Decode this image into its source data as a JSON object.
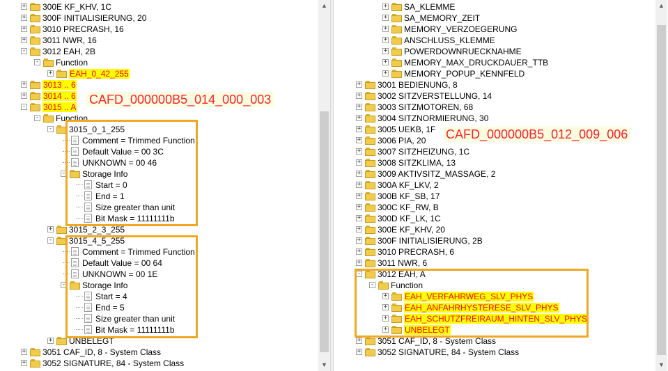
{
  "left": {
    "nodes": [
      {
        "label": "300E KF_KHV, 1C",
        "type": "folder",
        "expander": "+",
        "depth": 0
      },
      {
        "label": "300F INITIALISIERUNG, 20",
        "type": "folder",
        "expander": "+",
        "depth": 0
      },
      {
        "label": "3010 PRECRASH, 16",
        "type": "folder",
        "expander": "+",
        "depth": 0
      },
      {
        "label": "3011 NWR, 16",
        "type": "folder",
        "expander": "+",
        "depth": 0
      },
      {
        "label": "3012 EAH, 2B",
        "type": "folder",
        "expander": "-",
        "depth": 0
      },
      {
        "label": "Function",
        "type": "folder",
        "expander": "-",
        "depth": 1
      },
      {
        "label": "EAH_0_42_255",
        "type": "folder",
        "expander": "+",
        "depth": 2,
        "highlight": "band"
      },
      {
        "label": "3013 .. 6",
        "type": "folder",
        "expander": "+",
        "depth": 0,
        "highlight": "band"
      },
      {
        "label": "3014 .. 6",
        "type": "folder",
        "expander": "+",
        "depth": 0,
        "highlight": "band"
      },
      {
        "label": "3015 .. A",
        "type": "folder",
        "expander": "-",
        "depth": 0,
        "highlight": "band"
      },
      {
        "label": "Function",
        "type": "folder",
        "expander": "-",
        "depth": 1
      },
      {
        "label": "3015_0_1_255",
        "type": "folder",
        "expander": "-",
        "depth": 2
      },
      {
        "label": "Comment = Trimmed Function",
        "type": "doc",
        "depth": 3
      },
      {
        "label": "Default Value =  00 3C",
        "type": "doc",
        "depth": 3
      },
      {
        "label": "UNKNOWN = 00 46",
        "type": "doc",
        "depth": 3
      },
      {
        "label": "Storage Info",
        "type": "folder",
        "expander": "-",
        "depth": 3
      },
      {
        "label": "Start = 0",
        "type": "doc",
        "depth": 4
      },
      {
        "label": "End = 1",
        "type": "doc",
        "depth": 4
      },
      {
        "label": "Size greater than unit",
        "type": "doc",
        "depth": 4
      },
      {
        "label": "Bit Mask = 11111111b",
        "type": "doc",
        "depth": 4
      },
      {
        "label": "3015_2_3_255",
        "type": "folder",
        "expander": "+",
        "depth": 2
      },
      {
        "label": "3015_4_5_255",
        "type": "folder",
        "expander": "-",
        "depth": 2
      },
      {
        "label": "Comment = Trimmed Function",
        "type": "doc",
        "depth": 3
      },
      {
        "label": "Default Value =  00 64",
        "type": "doc",
        "depth": 3
      },
      {
        "label": "UNKNOWN = 00 1E",
        "type": "doc",
        "depth": 3
      },
      {
        "label": "Storage Info",
        "type": "folder",
        "expander": "-",
        "depth": 3
      },
      {
        "label": "Start = 4",
        "type": "doc",
        "depth": 4
      },
      {
        "label": "End = 5",
        "type": "doc",
        "depth": 4
      },
      {
        "label": "Size greater than unit",
        "type": "doc",
        "depth": 4
      },
      {
        "label": "Bit Mask = 11111111b",
        "type": "doc",
        "depth": 4
      },
      {
        "label": "UNBELEGT",
        "type": "folder",
        "expander": "+",
        "depth": 2
      },
      {
        "label": "3051 CAF_ID, 8  - System Class",
        "type": "folder",
        "expander": "+",
        "depth": 0
      },
      {
        "label": "3052 SIGNATURE, 84  - System Class",
        "type": "folder",
        "expander": "+",
        "depth": 0
      }
    ],
    "annotation": "CAFD_000000B5_014_000_003"
  },
  "right": {
    "nodes": [
      {
        "label": "SA_KLEMME",
        "type": "folder",
        "expander": "+",
        "depth": 2
      },
      {
        "label": "SA_MEMORY_ZEIT",
        "type": "folder",
        "expander": "+",
        "depth": 2
      },
      {
        "label": "MEMORY_VERZOEGERUNG",
        "type": "folder",
        "expander": "+",
        "depth": 2
      },
      {
        "label": "ANSCHLUSS_KLEMME",
        "type": "folder",
        "expander": "+",
        "depth": 2
      },
      {
        "label": "POWERDOWNRUECKNAHME",
        "type": "folder",
        "expander": "+",
        "depth": 2
      },
      {
        "label": "MEMORY_MAX_DRUCKDAUER_TTB",
        "type": "folder",
        "expander": "+",
        "depth": 2
      },
      {
        "label": "MEMORY_POPUP_KENNFELD",
        "type": "folder",
        "expander": "+",
        "depth": 2
      },
      {
        "label": "3001 BEDIENUNG, 8",
        "type": "folder",
        "expander": "+",
        "depth": 0
      },
      {
        "label": "3002 SITZVERSTELLUNG, 14",
        "type": "folder",
        "expander": "+",
        "depth": 0
      },
      {
        "label": "3003 SITZMOTOREN, 68",
        "type": "folder",
        "expander": "+",
        "depth": 0
      },
      {
        "label": "3004 SITZNORMIERUNG, 30",
        "type": "folder",
        "expander": "+",
        "depth": 0
      },
      {
        "label": "3005 UEKB, 1F",
        "type": "folder",
        "expander": "+",
        "depth": 0
      },
      {
        "label": "3006 PIA, 20",
        "type": "folder",
        "expander": "+",
        "depth": 0
      },
      {
        "label": "3007 SITZHEIZUNG, 1C",
        "type": "folder",
        "expander": "+",
        "depth": 0
      },
      {
        "label": "3008 SITZKLIMA, 13",
        "type": "folder",
        "expander": "+",
        "depth": 0
      },
      {
        "label": "3009 AKTIVSITZ_MASSAGE, 2",
        "type": "folder",
        "expander": "+",
        "depth": 0
      },
      {
        "label": "300A KF_LKV, 2",
        "type": "folder",
        "expander": "+",
        "depth": 0
      },
      {
        "label": "300B KF_SB, 17",
        "type": "folder",
        "expander": "+",
        "depth": 0
      },
      {
        "label": "300C KF_RW, B",
        "type": "folder",
        "expander": "+",
        "depth": 0
      },
      {
        "label": "300D KF_LK, 1C",
        "type": "folder",
        "expander": "+",
        "depth": 0
      },
      {
        "label": "300E KF_KHV, 20",
        "type": "folder",
        "expander": "+",
        "depth": 0
      },
      {
        "label": "300F INITIALISIERUNG, 2B",
        "type": "folder",
        "expander": "+",
        "depth": 0
      },
      {
        "label": "3010 PRECRASH, 6",
        "type": "folder",
        "expander": "+",
        "depth": 0
      },
      {
        "label": "3011 NWR, 6",
        "type": "folder",
        "expander": "+",
        "depth": 0
      },
      {
        "label": "3012 EAH, A",
        "type": "folder",
        "expander": "-",
        "depth": 0
      },
      {
        "label": "Function",
        "type": "folder",
        "expander": "-",
        "depth": 1
      },
      {
        "label": "EAH_VERFAHRWEG_SLV_PHYS",
        "type": "folder",
        "expander": "+",
        "depth": 2,
        "highlight": "band"
      },
      {
        "label": "EAH_ANFAHRHYSTERESE_SLV_PHYS",
        "type": "folder",
        "expander": "+",
        "depth": 2,
        "highlight": "band"
      },
      {
        "label": "EAH_SCHUTZFREIRAUM_HINTEN_SLV_PHYS",
        "type": "folder",
        "expander": "+",
        "depth": 2,
        "highlight": "band"
      },
      {
        "label": "UNBELEGT",
        "type": "folder",
        "expander": "+",
        "depth": 2,
        "highlight": "band"
      },
      {
        "label": "3051 CAF_ID, 8  - System Class",
        "type": "folder",
        "expander": "+",
        "depth": 0
      },
      {
        "label": "3052 SIGNATURE, 84  - System Class",
        "type": "folder",
        "expander": "+",
        "depth": 0
      }
    ],
    "annotation": "CAFD_000000B5_012_009_006"
  },
  "colors": {
    "folder": "#f1cb4b",
    "highlight_bg": "#ffff00",
    "highlight_text": "#ff0000",
    "box": "#f0a824"
  },
  "scrollbar": {
    "up_icon": "triangle-up-icon",
    "down_icon": "triangle-down-icon"
  }
}
